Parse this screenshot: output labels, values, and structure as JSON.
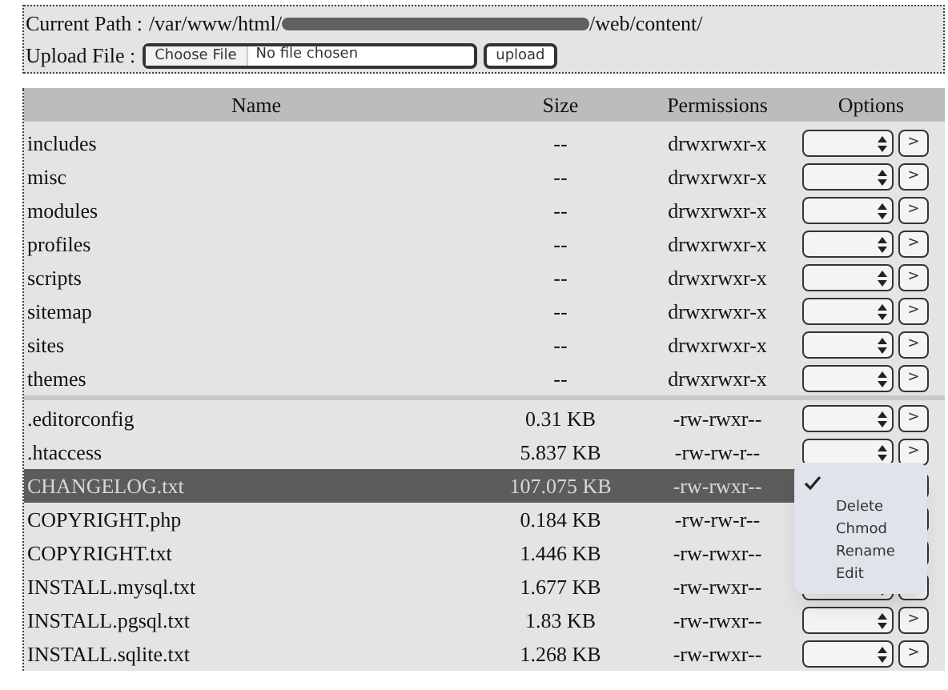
{
  "path_bar": {
    "label": "Current Path :",
    "path_start": "/var/www/html/",
    "path_end": "/web/content/"
  },
  "upload": {
    "label": "Upload File :",
    "choose_button": "Choose File",
    "status": "No file chosen",
    "button": "upload"
  },
  "table": {
    "columns": [
      "Name",
      "Size",
      "Permissions",
      "Options"
    ],
    "groups": [
      {
        "rows": [
          {
            "name": "includes",
            "size": "--",
            "permissions": "drwxrwxr-x",
            "selected": false
          },
          {
            "name": "misc",
            "size": "--",
            "permissions": "drwxrwxr-x",
            "selected": false
          },
          {
            "name": "modules",
            "size": "--",
            "permissions": "drwxrwxr-x",
            "selected": false
          },
          {
            "name": "profiles",
            "size": "--",
            "permissions": "drwxrwxr-x",
            "selected": false
          },
          {
            "name": "scripts",
            "size": "--",
            "permissions": "drwxrwxr-x",
            "selected": false
          },
          {
            "name": "sitemap",
            "size": "--",
            "permissions": "drwxrwxr-x",
            "selected": false
          },
          {
            "name": "sites",
            "size": "--",
            "permissions": "drwxrwxr-x",
            "selected": false
          },
          {
            "name": "themes",
            "size": "--",
            "permissions": "drwxrwxr-x",
            "selected": false
          }
        ]
      },
      {
        "rows": [
          {
            "name": ".editorconfig",
            "size": "0.31 KB",
            "permissions": "-rw-rwxr--",
            "selected": false
          },
          {
            "name": ".htaccess",
            "size": "5.837 KB",
            "permissions": "-rw-rw-r--",
            "selected": false
          },
          {
            "name": "CHANGELOG.txt",
            "size": "107.075 KB",
            "permissions": "-rw-rwxr--",
            "selected": true,
            "select_hidden": true
          },
          {
            "name": "COPYRIGHT.php",
            "size": "0.184 KB",
            "permissions": "-rw-rw-r--",
            "selected": false,
            "select_hidden": true
          },
          {
            "name": "COPYRIGHT.txt",
            "size": "1.446 KB",
            "permissions": "-rw-rwxr--",
            "selected": false,
            "select_hidden": true
          },
          {
            "name": "INSTALL.mysql.txt",
            "size": "1.677 KB",
            "permissions": "-rw-rwxr--",
            "selected": false
          },
          {
            "name": "INSTALL.pgsql.txt",
            "size": "1.83 KB",
            "permissions": "-rw-rwxr--",
            "selected": false
          },
          {
            "name": "INSTALL.sqlite.txt",
            "size": "1.268 KB",
            "permissions": "-rw-rwxr--",
            "selected": false
          }
        ]
      }
    ],
    "go_button": ">"
  },
  "open_menu": {
    "options": [
      {
        "checked": true
      },
      {
        "label": "Delete",
        "checked": false
      },
      {
        "label": "Chmod",
        "checked": false
      },
      {
        "label": "Rename",
        "checked": false
      },
      {
        "label": "Edit",
        "checked": false
      }
    ]
  }
}
